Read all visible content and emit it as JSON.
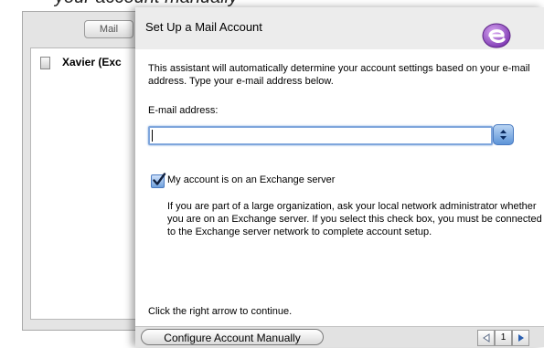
{
  "top_strip": {
    "text": "your account manually"
  },
  "background_window": {
    "tab_label": "Mail",
    "account_item": "Xavier (Exc"
  },
  "sheet": {
    "title": "Set Up a Mail Account",
    "intro": "This assistant will automatically determine your account settings based on your e-mail address. Type your e-mail address below.",
    "email_label": "E-mail address:",
    "email_value": "",
    "exchange_checkbox": {
      "label": "My account is on an Exchange server",
      "checked": true
    },
    "exchange_help": "If you are part of a large organization, ask your local network administrator whether you are on an Exchange server. If you select this check box, you must be connected to the Exchange server network to complete account setup.",
    "continue_text": "Click the right arrow to continue.",
    "configure_button": "Configure Account Manually",
    "page_number": "1"
  },
  "icons": {
    "app_icon": "entourage-e-icon",
    "popup": "popup-arrows-icon",
    "prev": "left-arrow-icon",
    "next": "right-arrow-icon"
  },
  "colors": {
    "focus_ring": "#7fa6dc",
    "aqua_blue": "#5d94d8",
    "app_icon_purple": "#8d4bc0"
  }
}
